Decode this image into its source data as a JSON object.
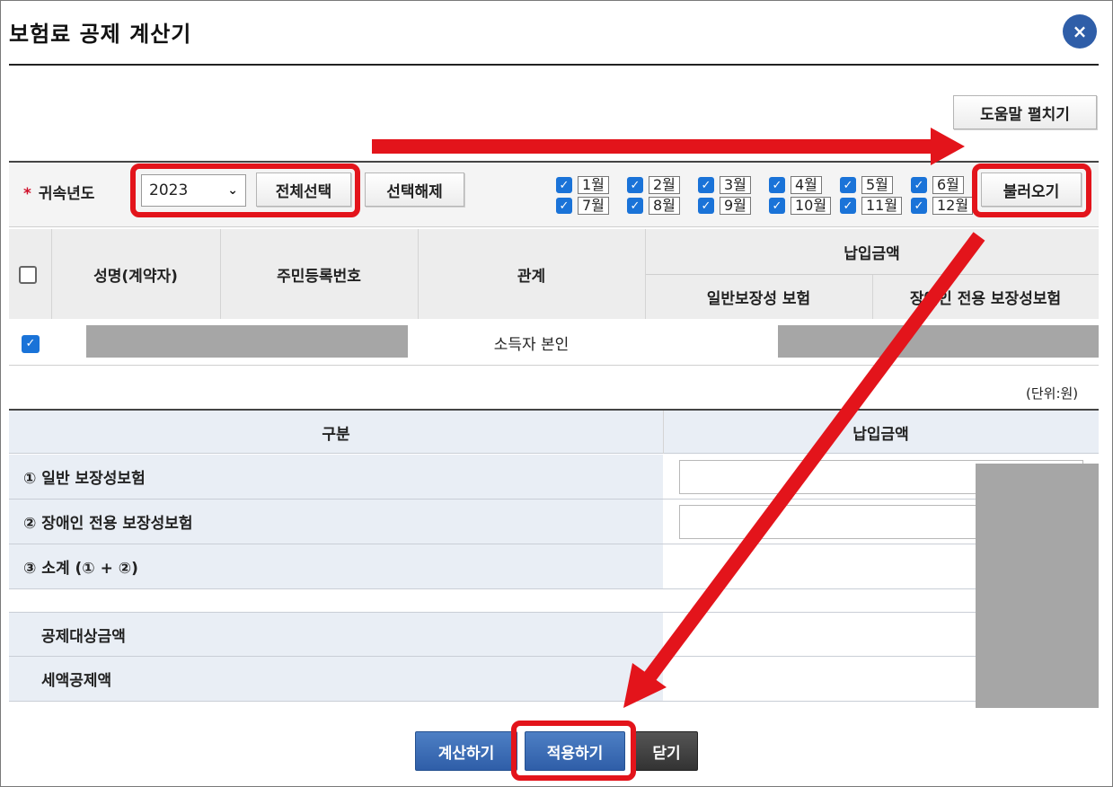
{
  "dialog": {
    "title": "보험료 공제 계산기",
    "close_symbol": "×"
  },
  "help_button": "도움말 펼치기",
  "filter": {
    "year_label": "귀속년도",
    "required_mark": "*",
    "year_value": "2023",
    "select_all": "전체선택",
    "deselect": "선택해제",
    "load": "불러오기",
    "months": [
      {
        "label": "1월",
        "checked": true
      },
      {
        "label": "2월",
        "checked": true
      },
      {
        "label": "3월",
        "checked": true
      },
      {
        "label": "4월",
        "checked": true
      },
      {
        "label": "5월",
        "checked": true
      },
      {
        "label": "6월",
        "checked": true
      },
      {
        "label": "7월",
        "checked": true
      },
      {
        "label": "8월",
        "checked": true
      },
      {
        "label": "9월",
        "checked": true
      },
      {
        "label": "10월",
        "checked": true
      },
      {
        "label": "11월",
        "checked": true
      },
      {
        "label": "12월",
        "checked": true
      }
    ]
  },
  "grid": {
    "headers": {
      "name": "성명(계약자)",
      "rrn": "주민등록번호",
      "relation": "관계",
      "paid": "납입금액",
      "general": "일반보장성 보험",
      "disabled": "장애인 전용 보장성보험"
    },
    "rows": [
      {
        "checked": true,
        "relation": "소득자 본인"
      }
    ]
  },
  "unit": "(단위:원)",
  "summary": {
    "col_category": "구분",
    "col_paid": "납입금액",
    "row1": "① 일반 보장성보험",
    "row2": "② 장애인 전용 보장성보험",
    "row3": "③ 소계 (① + ②)",
    "row4": "공제대상금액",
    "row5": "세액공제액"
  },
  "actions": {
    "calculate": "계산하기",
    "apply": "적용하기",
    "close": "닫기"
  },
  "colors": {
    "accent_blue": "#2f5ea8",
    "highlight_red": "#e3141b",
    "checkbox_blue": "#1a73d8"
  }
}
